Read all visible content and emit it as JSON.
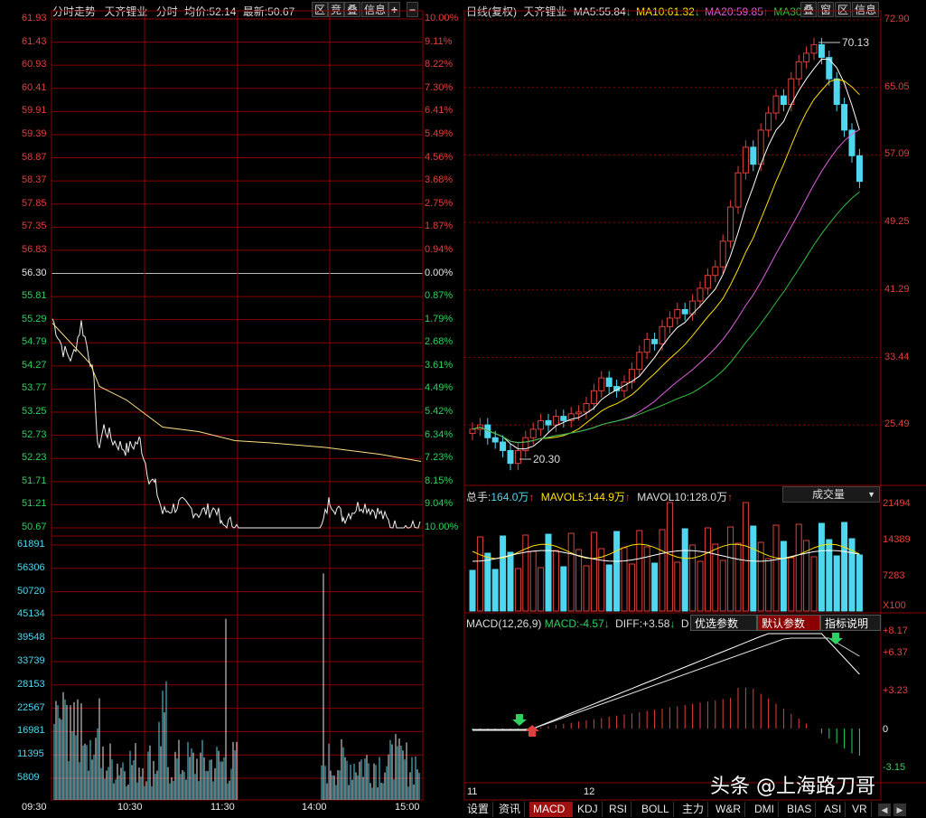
{
  "intraday": {
    "title": "分时走势",
    "stock": "天齐锂业",
    "mode": "分时",
    "avg_label": "均价:",
    "avg_value": "52.14",
    "latest_label": "最新:",
    "latest_value": "50.67",
    "buttons": [
      "区",
      "竞",
      "叠",
      "信息",
      "+",
      "−"
    ],
    "price_ticks": [
      "61.93",
      "61.43",
      "60.93",
      "60.41",
      "59.91",
      "59.39",
      "58.87",
      "58.37",
      "57.85",
      "57.35",
      "56.83",
      "56.30",
      "55.81",
      "55.29",
      "54.79",
      "54.27",
      "53.77",
      "53.25",
      "52.73",
      "52.23",
      "51.71",
      "51.21",
      "50.67"
    ],
    "pct_ticks": [
      "10.00%",
      "9.11%",
      "8.22%",
      "7.30%",
      "6.41%",
      "5.49%",
      "4.56%",
      "3.68%",
      "2.75%",
      "1.87%",
      "0.94%",
      "0.00%",
      "0.87%",
      "1.79%",
      "2.68%",
      "3.61%",
      "4.49%",
      "5.42%",
      "6.34%",
      "7.23%",
      "8.15%",
      "9.04%",
      "10.00%"
    ],
    "volume_ticks": [
      "61891",
      "56306",
      "50720",
      "45134",
      "39548",
      "33739",
      "28153",
      "22567",
      "16981",
      "11395",
      "5809"
    ],
    "time_ticks": [
      "09:30",
      "10:30",
      "11:30",
      "14:00",
      "15:00"
    ]
  },
  "daily": {
    "title": "日线(复权)",
    "stock": "天齐锂业",
    "ma5_label": "MA5:",
    "ma5_value": "55.84",
    "ma10_label": "MA10:",
    "ma10_value": "61.32",
    "ma20_label": "MA20:",
    "ma20_value": "59.85",
    "ma30_label": "MA30",
    "buttons": [
      "叠",
      "窗",
      "区",
      "信息"
    ],
    "price_ticks": [
      "72.90",
      "65.05",
      "57.09",
      "49.25",
      "41.29",
      "33.44",
      "25.49"
    ],
    "high_marker": "70.13",
    "low_marker": "20.30"
  },
  "volume": {
    "total_label": "总手:",
    "total_value": "164.0万",
    "mavol5_label": "MAVOL5:",
    "mavol5_value": "144.9万",
    "mavol10_label": "MAVOL10:",
    "mavol10_value": "128.0万",
    "dropdown": "成交量",
    "ticks": [
      "21494",
      "14389",
      "7283"
    ],
    "unit": "X100"
  },
  "macd": {
    "title": "MACD(12,26,9)",
    "macd_label": "MACD:",
    "macd_value": "-4.57",
    "diff_label": "DIFF:",
    "diff_value": "+3.58",
    "trailing_label": "D",
    "buttons": [
      "优选参数",
      "默认参数",
      "指标说明"
    ],
    "ticks": [
      "+8.17",
      "+6.37",
      "+3.23",
      "0",
      "-3.15"
    ]
  },
  "date_axis": [
    "11",
    "12"
  ],
  "bottom_tabs": [
    "设置",
    "资讯",
    "MACD",
    "KDJ",
    "RSI",
    "BOLL",
    "主力",
    "W&R",
    "DMI",
    "BIAS",
    "ASI",
    "VR"
  ],
  "watermark": "头条 @上海路刀哥",
  "colors": {
    "up": "#e0403c",
    "down": "#4fd7ef",
    "grid": "#8b0000",
    "ma5": "#ffffff",
    "ma10": "#ffe000",
    "ma20": "#e060e0",
    "ma30": "#30c040"
  }
}
